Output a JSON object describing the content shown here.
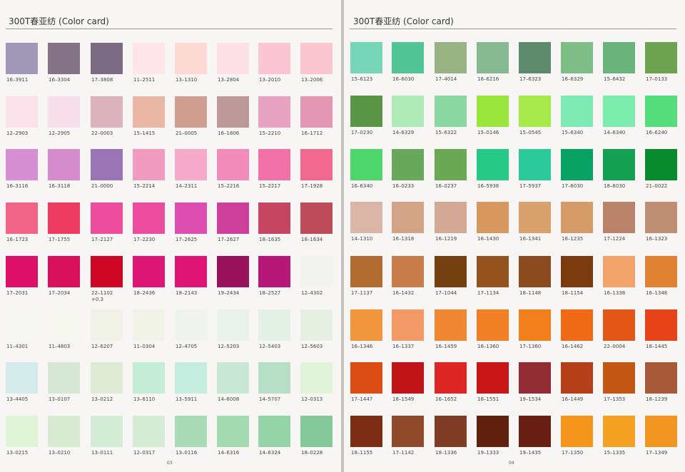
{
  "left_page": {
    "title": "300T春亚纺 (Color card)",
    "page_number": "03",
    "rows": [
      [
        {
          "code": "16-3911",
          "color": "#9f98b7"
        },
        {
          "code": "16-3304",
          "color": "#857487"
        },
        {
          "code": "17-3808",
          "color": "#7b6b82"
        },
        {
          "code": "11-2511",
          "color": "#fde6e9"
        },
        {
          "code": "13-1310",
          "color": "#fcd9d2"
        },
        {
          "code": "13-2804",
          "color": "#fde0e7"
        },
        {
          "code": "13-2010",
          "color": "#fbc6d4"
        },
        {
          "code": "13-2006",
          "color": "#fac6cf"
        }
      ],
      [
        {
          "code": "12-2903",
          "color": "#f9e2ea"
        },
        {
          "code": "12-2905",
          "color": "#f7e0ec"
        },
        {
          "code": "22-0003",
          "color": "#dcb3bd"
        },
        {
          "code": "15-1415",
          "color": "#ebb7a5"
        },
        {
          "code": "21-0005",
          "color": "#cfa092"
        },
        {
          "code": "16-1806",
          "color": "#bc9899"
        },
        {
          "code": "15-2210",
          "color": "#e8a3c1"
        },
        {
          "code": "16-1712",
          "color": "#e396b2"
        }
      ],
      [
        {
          "code": "16-3116",
          "color": "#d68fd2"
        },
        {
          "code": "16-3118",
          "color": "#d58ccd"
        },
        {
          "code": "21-0000",
          "color": "#9975b6"
        },
        {
          "code": "15-2214",
          "color": "#f29bc1"
        },
        {
          "code": "14-2311",
          "color": "#f6a9c8"
        },
        {
          "code": "15-2216",
          "color": "#f28bb9"
        },
        {
          "code": "15-2217",
          "color": "#f272a8"
        },
        {
          "code": "17-1928",
          "color": "#f2698f"
        }
      ],
      [
        {
          "code": "16-1723",
          "color": "#f26487"
        },
        {
          "code": "17-1755",
          "color": "#ed3a60"
        },
        {
          "code": "17-2127",
          "color": "#ee4c9c"
        },
        {
          "code": "17-2230",
          "color": "#ec4c9e"
        },
        {
          "code": "17-2625",
          "color": "#dc4eb0"
        },
        {
          "code": "17-2627",
          "color": "#ce3f9b"
        },
        {
          "code": "18-1635",
          "color": "#c54562"
        },
        {
          "code": "18-1634",
          "color": "#be4c5b"
        }
      ],
      [
        {
          "code": "17-2031",
          "color": "#dd0f66"
        },
        {
          "code": "17-2034",
          "color": "#d8105c"
        },
        {
          "code": "22-1102\n+0.3",
          "color": "#ce0724"
        },
        {
          "code": "18-2436",
          "color": "#dc1776"
        },
        {
          "code": "18-2143",
          "color": "#de1572"
        },
        {
          "code": "19-2434",
          "color": "#98125c"
        },
        {
          "code": "18-2527",
          "color": "#b6187a"
        },
        {
          "code": "12-4302",
          "color": "#f2f3ee"
        }
      ],
      [
        {
          "code": "11-4301",
          "color": "#f7f8f3"
        },
        {
          "code": "11-4803",
          "color": "#f5f7f0"
        },
        {
          "code": "12-6207",
          "color": "#f0f2e8"
        },
        {
          "code": "11-0304",
          "color": "#f0f3e6"
        },
        {
          "code": "12-4705",
          "color": "#eef3ef"
        },
        {
          "code": "12-5203",
          "color": "#e8f2ea"
        },
        {
          "code": "12-5403",
          "color": "#e4f0e6"
        },
        {
          "code": "12-5603",
          "color": "#e5f0e3"
        }
      ],
      [
        {
          "code": "13-4405",
          "color": "#d6ebec"
        },
        {
          "code": "13-0107",
          "color": "#d7e7d6"
        },
        {
          "code": "13-0212",
          "color": "#e0ebd5"
        },
        {
          "code": "13-6110",
          "color": "#c4ecd6"
        },
        {
          "code": "13-5911",
          "color": "#c4ede0"
        },
        {
          "code": "14-6008",
          "color": "#c9e7d5"
        },
        {
          "code": "14-5707",
          "color": "#b7dfc7"
        },
        {
          "code": "12-0313",
          "color": "#e0f3d8"
        }
      ],
      [
        {
          "code": "13-0215",
          "color": "#dff4d6"
        },
        {
          "code": "13-0210",
          "color": "#d8ebd2"
        },
        {
          "code": "13-0111",
          "color": "#d3ecd6"
        },
        {
          "code": "12-0317",
          "color": "#d4ecd4"
        },
        {
          "code": "13-0116",
          "color": "#a9dcb6"
        },
        {
          "code": "14-6316",
          "color": "#a4dab0"
        },
        {
          "code": "14-6324",
          "color": "#94d4a6"
        },
        {
          "code": "18-0228",
          "color": "#85c99a"
        }
      ]
    ]
  },
  "right_page": {
    "title": "300T春亚纺 (Color card)",
    "page_number": "04",
    "rows": [
      [
        {
          "code": "15-6123",
          "color": "#77d6b7"
        },
        {
          "code": "16-6030",
          "color": "#52c596"
        },
        {
          "code": "17-4014",
          "color": "#98b284"
        },
        {
          "code": "16-6216",
          "color": "#86b991"
        },
        {
          "code": "17-6323",
          "color": "#5e8a6e"
        },
        {
          "code": "16-6329",
          "color": "#7ebd86"
        },
        {
          "code": "15-6432",
          "color": "#6bb37d"
        },
        {
          "code": "17-0133",
          "color": "#6da24e"
        }
      ],
      [
        {
          "code": "17-0230",
          "color": "#5b9648"
        },
        {
          "code": "14-6329",
          "color": "#aeeab8"
        },
        {
          "code": "15-6322",
          "color": "#8ad7a1"
        },
        {
          "code": "15-0146",
          "color": "#9ae63e"
        },
        {
          "code": "15-0545",
          "color": "#a7e84a"
        },
        {
          "code": "15-6340",
          "color": "#7de9b3"
        },
        {
          "code": "14-6340",
          "color": "#7cecac"
        },
        {
          "code": "16-6240",
          "color": "#55dd7c"
        }
      ],
      [
        {
          "code": "16-6340",
          "color": "#4ed66d"
        },
        {
          "code": "16-0233",
          "color": "#67a85a"
        },
        {
          "code": "16-0237",
          "color": "#6aa853"
        },
        {
          "code": "16-5938",
          "color": "#25c887"
        },
        {
          "code": "17-5937",
          "color": "#2cc99a"
        },
        {
          "code": "17-6030",
          "color": "#08a364"
        },
        {
          "code": "18-6030",
          "color": "#14a052"
        },
        {
          "code": "21-0022",
          "color": "#078b2c"
        }
      ],
      [
        {
          "code": "14-1310",
          "color": "#dcb5a9"
        },
        {
          "code": "16-1318",
          "color": "#d2a385"
        },
        {
          "code": "16-1219",
          "color": "#d3a895"
        },
        {
          "code": "16-1430",
          "color": "#d7975f"
        },
        {
          "code": "16-1341",
          "color": "#d9a26c"
        },
        {
          "code": "16-1235",
          "color": "#d59c6a"
        },
        {
          "code": "17-1224",
          "color": "#b8826b"
        },
        {
          "code": "16-1323",
          "color": "#c09076"
        }
      ],
      [
        {
          "code": "17-1137",
          "color": "#b16d31"
        },
        {
          "code": "16-1432",
          "color": "#c87d4b"
        },
        {
          "code": "17-1044",
          "color": "#74400f"
        },
        {
          "code": "17-1134",
          "color": "#94531e"
        },
        {
          "code": "18-1148",
          "color": "#8b4b1f"
        },
        {
          "code": "18-1154",
          "color": "#7c3b0e"
        },
        {
          "code": "16-1338",
          "color": "#f2a369"
        },
        {
          "code": "16-1348",
          "color": "#e08232"
        }
      ],
      [
        {
          "code": "16-1346",
          "color": "#f1963d"
        },
        {
          "code": "16-1337",
          "color": "#f39966"
        },
        {
          "code": "16-1459",
          "color": "#f08732"
        },
        {
          "code": "16-1360",
          "color": "#f17f24"
        },
        {
          "code": "17-1360",
          "color": "#f07f1c"
        },
        {
          "code": "16-1462",
          "color": "#f06a16"
        },
        {
          "code": "22-0004",
          "color": "#e35716"
        },
        {
          "code": "18-1445",
          "color": "#e84218"
        }
      ],
      [
        {
          "code": "17-1447",
          "color": "#dc4d16"
        },
        {
          "code": "18-1549",
          "color": "#c11418"
        },
        {
          "code": "16-1652",
          "color": "#de2725"
        },
        {
          "code": "18-1551",
          "color": "#c81616"
        },
        {
          "code": "19-1534",
          "color": "#922c34"
        },
        {
          "code": "16-1449",
          "color": "#b44019"
        },
        {
          "code": "17-1353",
          "color": "#c25716"
        },
        {
          "code": "18-1239",
          "color": "#a65a38"
        }
      ],
      [
        {
          "code": "18-1155",
          "color": "#7c2e14"
        },
        {
          "code": "17-1142",
          "color": "#8e4a2a"
        },
        {
          "code": "18-1336",
          "color": "#7e3d24"
        },
        {
          "code": "19-1333",
          "color": "#60220f"
        },
        {
          "code": "19-1435",
          "color": "#6a1f14"
        },
        {
          "code": "17-1350",
          "color": "#f6951c"
        },
        {
          "code": "15-1335",
          "color": "#f5a124"
        },
        {
          "code": "17-1349",
          "color": "#f29520"
        }
      ]
    ]
  }
}
